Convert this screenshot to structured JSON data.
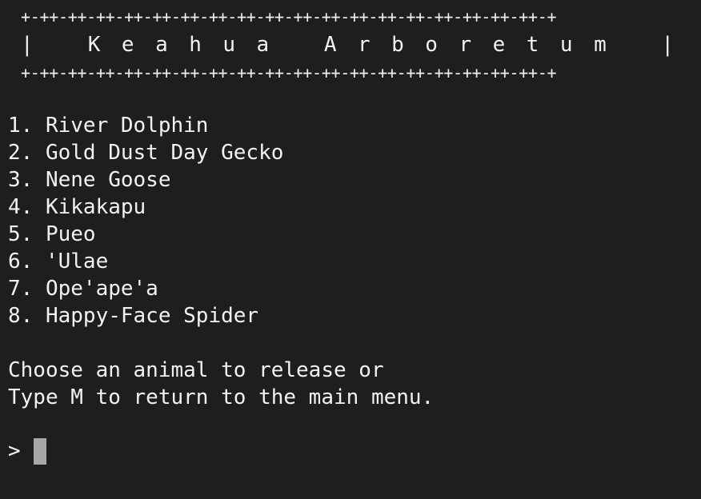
{
  "banner": {
    "border": "+-++-++-++-++-++-++-++-++-++-++-++-++-++-++-++-++-++-++-+",
    "pipe_left": "|",
    "title": "Keahua Arboretum",
    "pipe_right": "|"
  },
  "menu": {
    "items": [
      "1. River Dolphin",
      "2. Gold Dust Day Gecko",
      "3. Nene Goose",
      "4. Kikakapu",
      "5. Pueo",
      "6. 'Ulae",
      "7. Ope'ape'a",
      "8. Happy-Face Spider"
    ]
  },
  "instructions": {
    "line1": "Choose an animal to release or",
    "line2": "Type M to return to the main menu."
  },
  "prompt": {
    "symbol": ">"
  },
  "colors": {
    "background": "#1e1e1e",
    "foreground": "#f2f2f2",
    "cursor": "#a7a7a7"
  }
}
